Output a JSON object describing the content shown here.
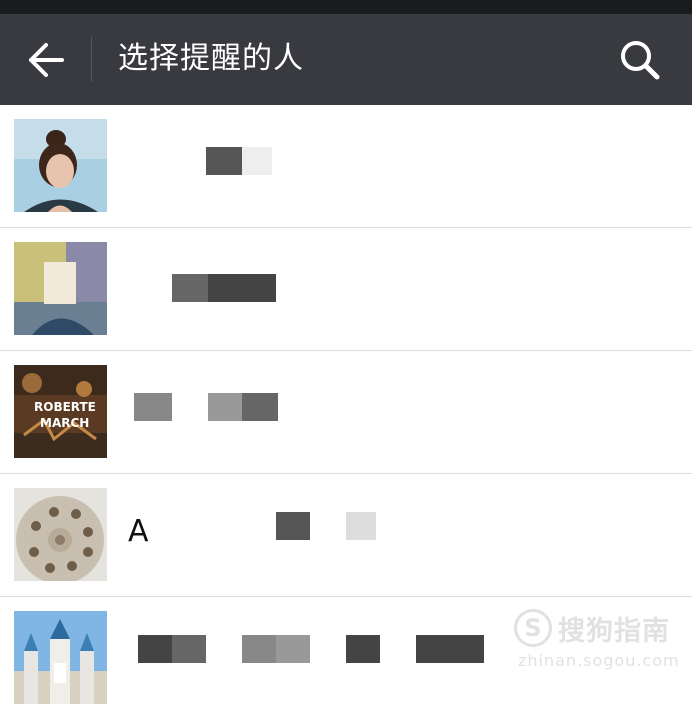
{
  "header": {
    "title": "选择提醒的人",
    "back_icon": "arrow-left-icon",
    "search_icon": "search-icon",
    "background": "#393a3f"
  },
  "contacts": [
    {
      "name": "",
      "avatar": "portrait-woman-bun"
    },
    {
      "name": "",
      "avatar": "portrait-man-face-blurred"
    },
    {
      "name": "",
      "avatar": "album-cover-roberte-march"
    },
    {
      "name": "A",
      "avatar": "wooden-disc-with-holes"
    },
    {
      "name": "",
      "avatar": "castle-photo"
    }
  ],
  "watermark": {
    "title": "搜狗指南",
    "url": "zhinan.sogou.com"
  }
}
